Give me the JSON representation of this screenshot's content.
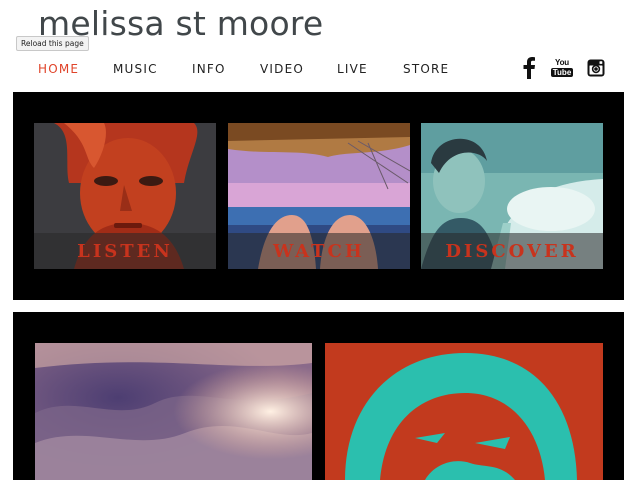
{
  "site": {
    "title": "melissa st moore"
  },
  "tooltip": {
    "text": "Reload this page"
  },
  "nav": {
    "items": [
      {
        "label": "HOME",
        "active": true
      },
      {
        "label": "MUSIC",
        "active": false
      },
      {
        "label": "INFO",
        "active": false
      },
      {
        "label": "VIDEO",
        "active": false
      },
      {
        "label": "LIVE",
        "active": false
      },
      {
        "label": "STORE",
        "active": false
      }
    ]
  },
  "social": {
    "facebook_glyph": "f",
    "youtube_you": "You",
    "youtube_tube": "Tube",
    "icons": [
      "facebook-icon",
      "youtube-icon",
      "instagram-icon"
    ]
  },
  "tiles": [
    {
      "label": "LISTEN"
    },
    {
      "label": "WATCH"
    },
    {
      "label": "DISCOVER"
    }
  ],
  "colors": {
    "accent": "#e0442a",
    "label": "#c8331d",
    "panel": "#000000",
    "title": "#41474a"
  }
}
